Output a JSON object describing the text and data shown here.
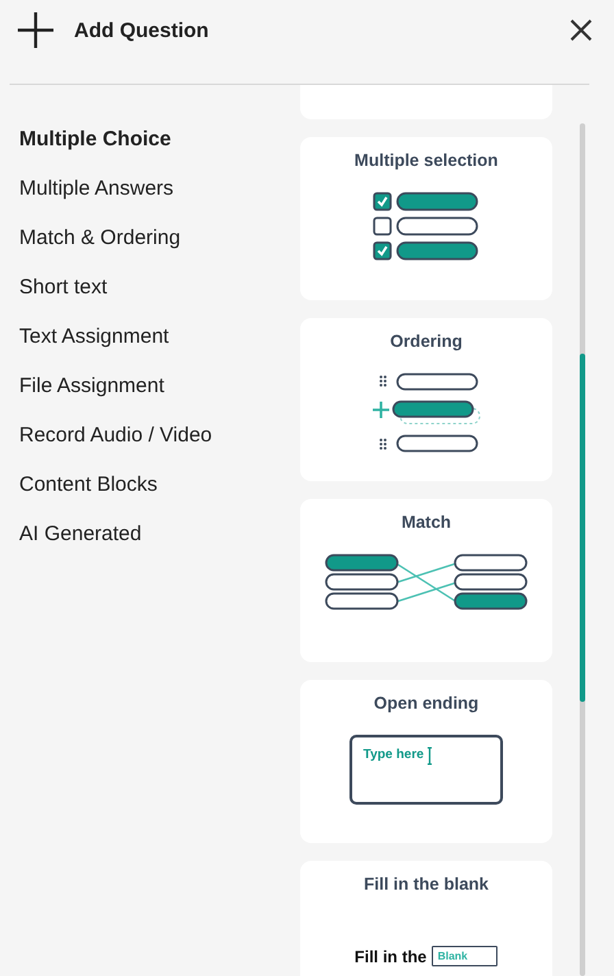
{
  "header": {
    "title": "Add Question"
  },
  "categories": [
    {
      "label": "Multiple Choice",
      "selected": true
    },
    {
      "label": "Multiple Answers",
      "selected": false
    },
    {
      "label": "Match & Ordering",
      "selected": false
    },
    {
      "label": "Short text",
      "selected": false
    },
    {
      "label": "Text Assignment",
      "selected": false
    },
    {
      "label": "File Assignment",
      "selected": false
    },
    {
      "label": "Record Audio / Video",
      "selected": false
    },
    {
      "label": "Content Blocks",
      "selected": false
    },
    {
      "label": "AI Generated",
      "selected": false
    }
  ],
  "cards": [
    {
      "kind": "multi_select",
      "title": "Multiple selection"
    },
    {
      "kind": "ordering",
      "title": "Ordering"
    },
    {
      "kind": "match",
      "title": "Match"
    },
    {
      "kind": "open",
      "title": "Open ending",
      "placeholder": "Type here"
    },
    {
      "kind": "fill",
      "title": "Fill in the blank",
      "sentence": "Fill in the",
      "blank": "Blank"
    }
  ]
}
